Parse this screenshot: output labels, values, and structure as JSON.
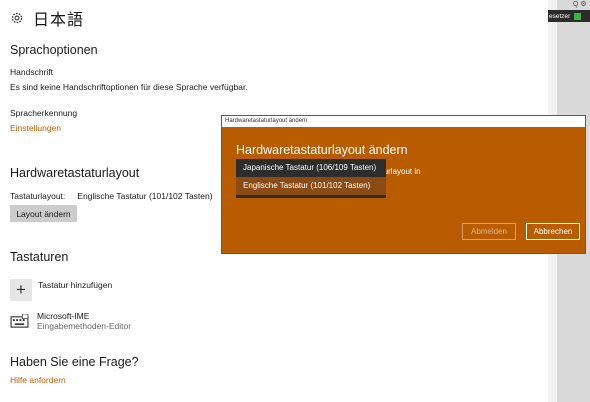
{
  "page": {
    "title": "日本語"
  },
  "language_options": {
    "heading": "Sprachoptionen",
    "handwriting_label": "Handschrift",
    "handwriting_text": "Es sind keine Handschriftoptionen für diese Sprache verfügbar.",
    "speech_label": "Spracherkennung",
    "settings_link": "Einstellungen"
  },
  "hardware_layout": {
    "heading": "Hardwaretastaturlayout",
    "layout_label": "Tastaturlayout:",
    "layout_value": "Englische Tastatur (101/102 Tasten)",
    "change_button": "Layout ändern"
  },
  "keyboards": {
    "heading": "Tastaturen",
    "add_label": "Tastatur hinzufügen",
    "ime_name": "Microsoft-IME",
    "ime_desc": "Eingabemethoden-Editor"
  },
  "question": {
    "heading": "Haben Sie eine Frage?",
    "help_link": "Hilfe anfordern"
  },
  "right_panel": {
    "bar_text": "esetzer",
    "icons": "Q ⚙"
  },
  "dialog": {
    "window_title": "Hardwaretastaturlayout ändern",
    "heading": "Hardwaretastaturlayout ändern",
    "hint_text": "aturlayout in",
    "options": [
      "Japanische Tastatur (106/109 Tasten)",
      "Englische Tastatur (101/102 Tasten)"
    ],
    "selected_index": 1,
    "signout_button": "Abmelden",
    "cancel_button": "Abbrechen"
  },
  "colors": {
    "accent": "#c15a00",
    "dialog_bg": "#b95c00"
  }
}
